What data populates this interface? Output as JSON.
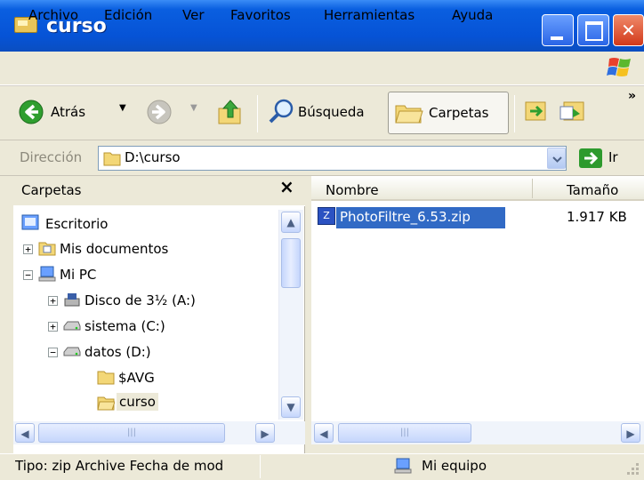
{
  "window": {
    "title": "curso"
  },
  "menu": [
    "Archivo",
    "Edición",
    "Ver",
    "Favoritos",
    "Herramientas",
    "Ayuda"
  ],
  "toolbar": {
    "back_label": "Atrás",
    "search_label": "Búsqueda",
    "folders_label": "Carpetas"
  },
  "address": {
    "label": "Dirección",
    "value": "D:\\curso",
    "go_label": "Ir"
  },
  "folder_pane": {
    "title": "Carpetas",
    "tree": [
      {
        "label": "Escritorio"
      },
      {
        "label": "Mis documentos"
      },
      {
        "label": "Mi PC"
      },
      {
        "label": "Disco de 3½ (A:)"
      },
      {
        "label": "sistema (C:)"
      },
      {
        "label": "datos (D:)"
      },
      {
        "label": "$AVG"
      },
      {
        "label": "curso"
      }
    ]
  },
  "files_pane": {
    "columns": [
      "Nombre",
      "Tamaño"
    ],
    "rows": [
      {
        "name": "PhotoFiltre_6.53.zip",
        "size": "1.917 KB",
        "selected": true
      }
    ]
  },
  "statusbar": {
    "info": "Tipo: zip Archive Fecha de mod",
    "zone": "Mi equipo"
  },
  "colors": {
    "titlebar": "#0653d6",
    "selection": "#316ac5",
    "chrome": "#ece9d8"
  }
}
